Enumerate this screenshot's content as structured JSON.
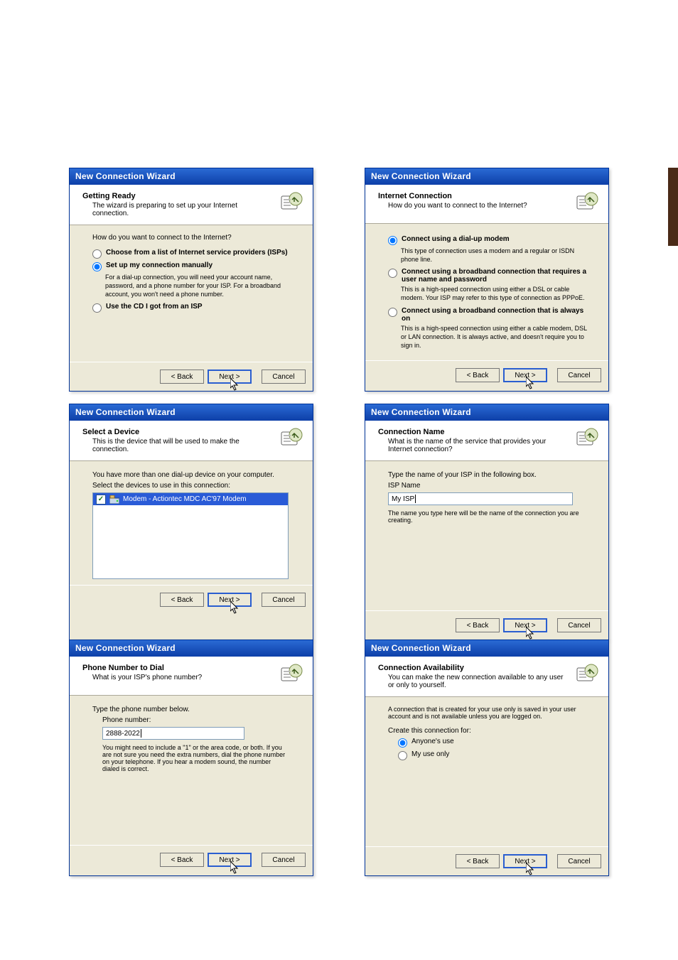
{
  "common": {
    "title": "New Connection Wizard",
    "back": "< Back",
    "next": "Next >",
    "cancel": "Cancel"
  },
  "wiz1": {
    "heading": "Getting Ready",
    "sub": "The wizard is preparing to set up your Internet connection.",
    "question": "How do you want to connect to the Internet?",
    "opt1": "Choose from a list of Internet service providers (ISPs)",
    "opt2": "Set up my connection manually",
    "opt2desc": "For a dial-up connection, you will need your account name, password, and a phone number for your ISP. For a broadband account, you won't need a phone number.",
    "opt3": "Use the CD I got from an ISP"
  },
  "wiz2": {
    "heading": "Internet Connection",
    "sub": "How do you want to connect to the Internet?",
    "opt1": "Connect using a dial-up modem",
    "opt1desc": "This type of connection uses a modem and a regular or ISDN phone line.",
    "opt2": "Connect using a broadband connection that requires a user name and password",
    "opt2desc": "This is a high-speed connection using either a DSL or cable modem. Your ISP may refer to this type of connection as PPPoE.",
    "opt3": "Connect using a broadband connection that is always on",
    "opt3desc": "This is a high-speed connection using either a cable modem, DSL or LAN connection. It is always active, and doesn't require you to sign in."
  },
  "wiz3": {
    "heading": "Select a Device",
    "sub": "This is the device that will be used to make the connection.",
    "line1": "You have more than one dial-up device on your computer.",
    "line2": "Select the devices to use in this connection:",
    "device": "Modem - Actiontec MDC AC'97 Modem"
  },
  "wiz4": {
    "heading": "Connection Name",
    "sub": "What is the name of the service that provides your Internet connection?",
    "prompt": "Type the name of your ISP in the following box.",
    "label": "ISP Name",
    "value": "My ISP",
    "note": "The name you type here will be the name of the connection you are creating."
  },
  "wiz5": {
    "heading": "Phone Number to Dial",
    "sub": "What is your ISP's phone number?",
    "prompt": "Type the phone number below.",
    "label": "Phone number:",
    "value": "2888-2022",
    "note": "You might need to include a \"1\" or the area code, or both. If you are not sure you need the extra numbers, dial the phone number on your telephone. If you hear a modem sound, the number dialed is correct."
  },
  "wiz6": {
    "heading": "Connection Availability",
    "sub": "You can make the new connection available to any user or only to yourself.",
    "note": "A connection that is created for your use only is saved in your user account and is not available unless you are logged on.",
    "prompt": "Create this connection for:",
    "opt1": "Anyone's use",
    "opt2": "My use only"
  }
}
